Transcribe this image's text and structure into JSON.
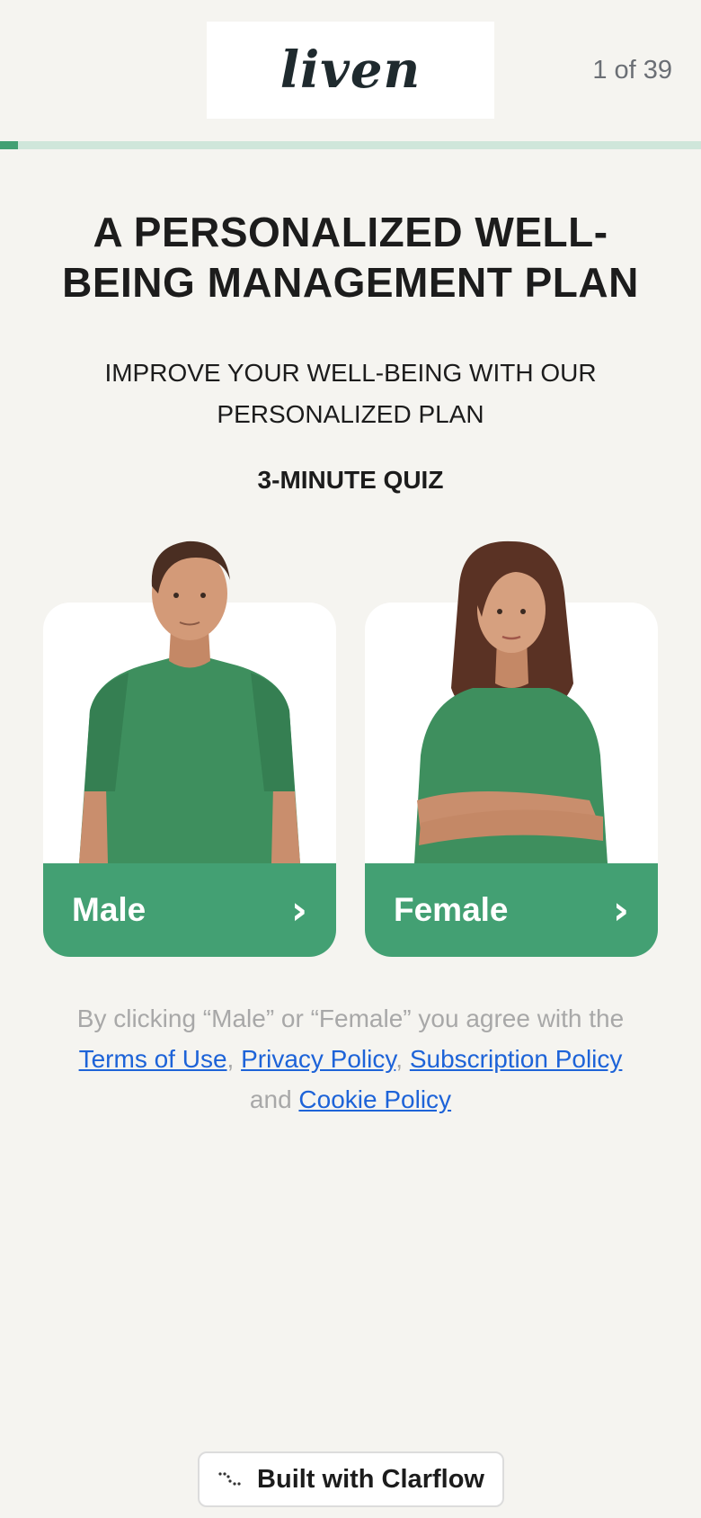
{
  "header": {
    "logo_text": "liven",
    "step_counter": "1 of 39",
    "progress_fraction": 0.0256
  },
  "main": {
    "title": "A PERSONALIZED WELL-BEING MANAGEMENT PLAN",
    "subtitle": "IMPROVE YOUR WELL-BEING WITH OUR PERSONALIZED PLAN",
    "quiz_label": "3-MINUTE QUIZ"
  },
  "options": [
    {
      "label": "Male",
      "icon": "chevron-right-icon"
    },
    {
      "label": "Female",
      "icon": "chevron-right-icon"
    }
  ],
  "legal": {
    "prefix": "By clicking “Male” or “Female” you agree with the",
    "terms": "Terms of Use",
    "sep1": ",",
    "privacy": "Privacy Policy",
    "sep2": ",",
    "subscription": "Subscription Policy",
    "and": "and",
    "cookie": "Cookie Policy"
  },
  "footer": {
    "built_with": "Built with Clarflow",
    "icon": "clarflow-logo-icon"
  },
  "colors": {
    "accent": "#43a073",
    "background": "#f5f4f0",
    "link": "#1d63d8"
  }
}
